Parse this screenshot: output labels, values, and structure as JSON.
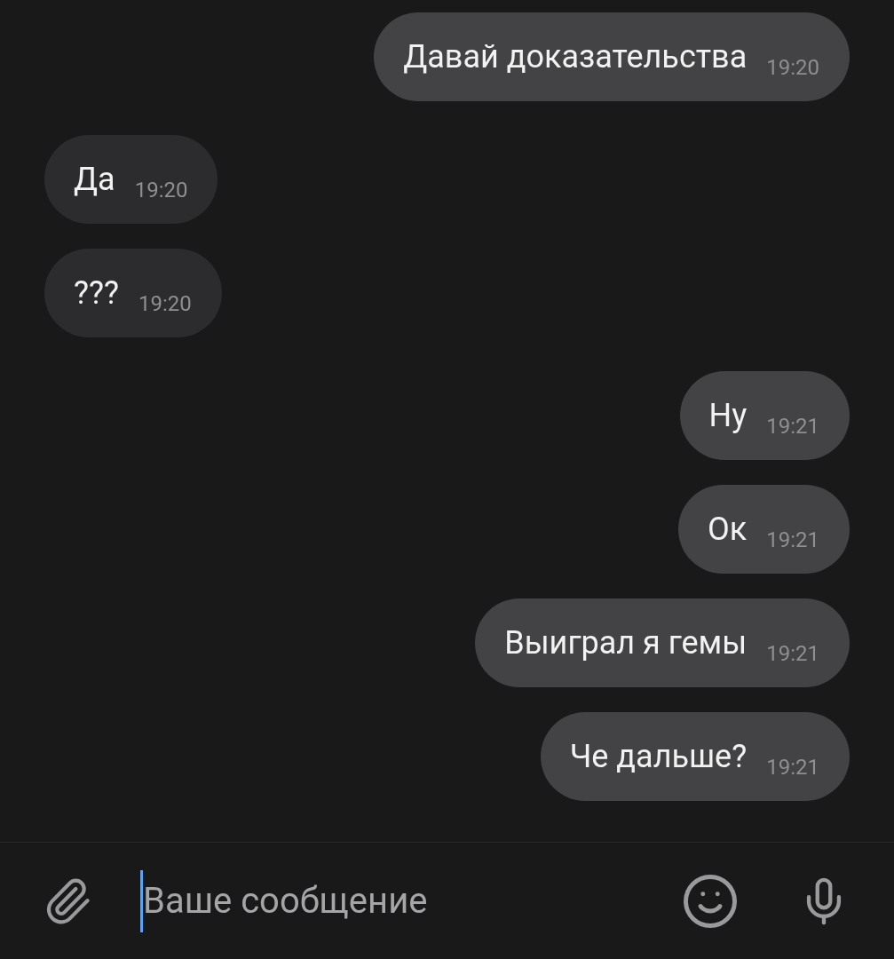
{
  "messages": [
    {
      "text": "Давай доказательства",
      "time": "19:20",
      "outgoing": true
    },
    {
      "text": "Да",
      "time": "19:20",
      "outgoing": false
    },
    {
      "text": "???",
      "time": "19:20",
      "outgoing": false
    },
    {
      "text": "Ну",
      "time": "19:21",
      "outgoing": true
    },
    {
      "text": "Ок",
      "time": "19:21",
      "outgoing": true
    },
    {
      "text": "Выиграл я гемы",
      "time": "19:21",
      "outgoing": true
    },
    {
      "text": "Че дальше?",
      "time": "19:21",
      "outgoing": true
    }
  ],
  "composer": {
    "placeholder": "Ваше сообщение"
  }
}
